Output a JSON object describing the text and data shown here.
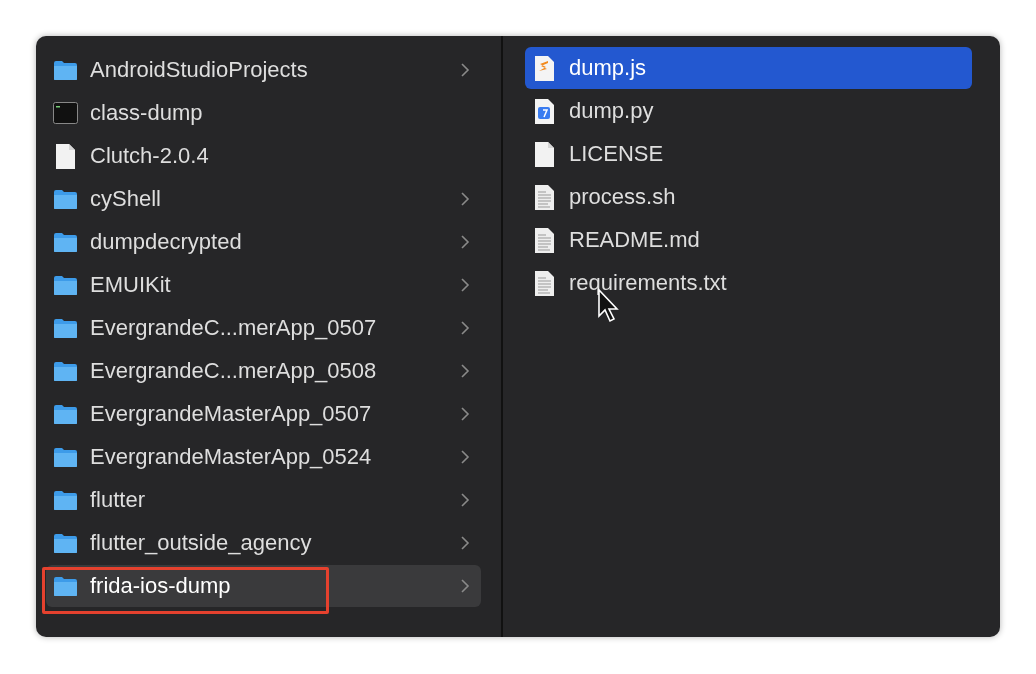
{
  "columns": [
    {
      "items": [
        {
          "name": "AndroidStudioProjects",
          "kind": "folder",
          "has_children": true,
          "selected": false,
          "marked": false
        },
        {
          "name": "class-dump",
          "kind": "executable",
          "has_children": false,
          "selected": false,
          "marked": false
        },
        {
          "name": "Clutch-2.0.4",
          "kind": "document",
          "has_children": false,
          "selected": false,
          "marked": false
        },
        {
          "name": "cyShell",
          "kind": "folder",
          "has_children": true,
          "selected": false,
          "marked": false
        },
        {
          "name": "dumpdecrypted",
          "kind": "folder",
          "has_children": true,
          "selected": false,
          "marked": false
        },
        {
          "name": "EMUIKit",
          "kind": "folder",
          "has_children": true,
          "selected": false,
          "marked": false
        },
        {
          "name": "EvergrandeC...merApp_0507",
          "kind": "folder",
          "has_children": true,
          "selected": false,
          "marked": false
        },
        {
          "name": "EvergrandeC...merApp_0508",
          "kind": "folder",
          "has_children": true,
          "selected": false,
          "marked": false
        },
        {
          "name": "EvergrandeMasterApp_0507",
          "kind": "folder",
          "has_children": true,
          "selected": false,
          "marked": false
        },
        {
          "name": "EvergrandeMasterApp_0524",
          "kind": "folder",
          "has_children": true,
          "selected": false,
          "marked": false
        },
        {
          "name": "flutter",
          "kind": "folder",
          "has_children": true,
          "selected": false,
          "marked": false
        },
        {
          "name": "flutter_outside_agency",
          "kind": "folder",
          "has_children": true,
          "selected": false,
          "marked": false
        },
        {
          "name": "frida-ios-dump",
          "kind": "folder",
          "has_children": true,
          "selected": true,
          "marked": true
        }
      ]
    },
    {
      "items": [
        {
          "name": "dump.js",
          "kind": "script",
          "has_children": false,
          "selected": true,
          "marked": false
        },
        {
          "name": "dump.py",
          "kind": "python",
          "has_children": false,
          "selected": false,
          "marked": false
        },
        {
          "name": "LICENSE",
          "kind": "document",
          "has_children": false,
          "selected": false,
          "marked": false
        },
        {
          "name": "process.sh",
          "kind": "text",
          "has_children": false,
          "selected": false,
          "marked": false
        },
        {
          "name": "README.md",
          "kind": "text",
          "has_children": false,
          "selected": false,
          "marked": false
        },
        {
          "name": "requirements.txt",
          "kind": "text",
          "has_children": false,
          "selected": false,
          "marked": false
        }
      ]
    }
  ]
}
